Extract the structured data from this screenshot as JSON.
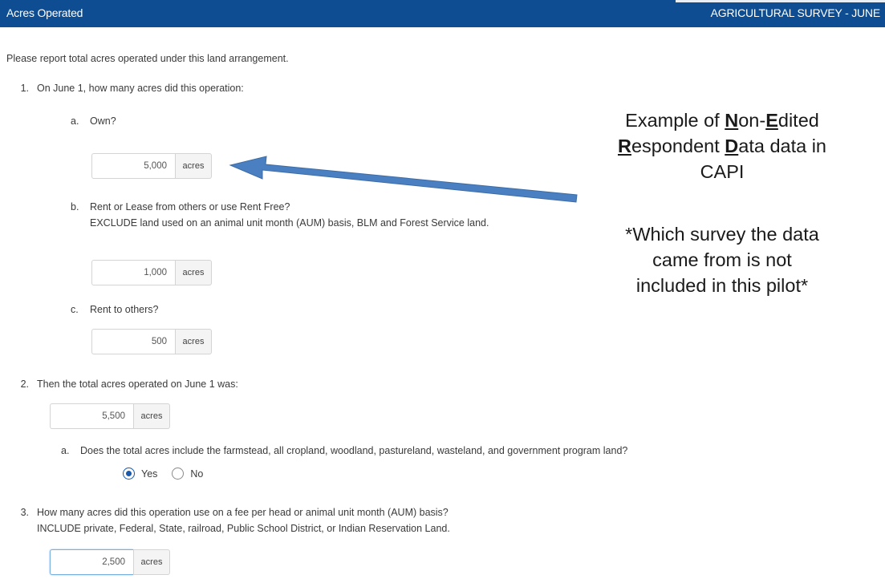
{
  "header": {
    "title": "Acres Operated",
    "survey": "AGRICULTURAL SURVEY - JUNE"
  },
  "intro": "Please report total acres operated under this land arrangement.",
  "q1": {
    "number": "1.",
    "text": "On June 1, how many acres did this operation:",
    "a": {
      "letter": "a.",
      "text": "Own?",
      "value": "5,000",
      "unit": "acres"
    },
    "b": {
      "letter": "b.",
      "text": "Rent or Lease from others or use Rent Free?",
      "note": "EXCLUDE land used on an animal unit month (AUM) basis, BLM and Forest Service land.",
      "value": "1,000",
      "unit": "acres"
    },
    "c": {
      "letter": "c.",
      "text": "Rent to others?",
      "value": "500",
      "unit": "acres"
    }
  },
  "q2": {
    "number": "2.",
    "text": "Then the total acres operated on June 1 was:",
    "value": "5,500",
    "unit": "acres",
    "a": {
      "letter": "a.",
      "text": "Does the total acres include the farmstead, all cropland, woodland, pastureland, wasteland, and government program land?",
      "options": [
        "Yes",
        "No"
      ],
      "selected": "Yes"
    }
  },
  "q3": {
    "number": "3.",
    "text": "How many acres did this operation use on a fee per head or animal unit month (AUM) basis?",
    "note": "INCLUDE private, Federal, State, railroad, Public School District, or Indian Reservation Land.",
    "value": "2,500",
    "unit": "acres"
  },
  "annotation": {
    "line1_pre": "Example of ",
    "line1_n": "N",
    "line1_on": "on-",
    "line1_e": "E",
    "line1_dited": "dited",
    "line2_r": "R",
    "line2_espondent": "espondent ",
    "line2_d": "D",
    "line2_rest": "ata data in",
    "line3": "CAPI",
    "note_line1": "*Which survey the data",
    "note_line2": "came from is not",
    "note_line3": "included in this pilot*"
  },
  "colors": {
    "header_bg": "#0e4d91",
    "arrow": "#4a7fc1",
    "radio_checked": "#1a5aa8"
  }
}
